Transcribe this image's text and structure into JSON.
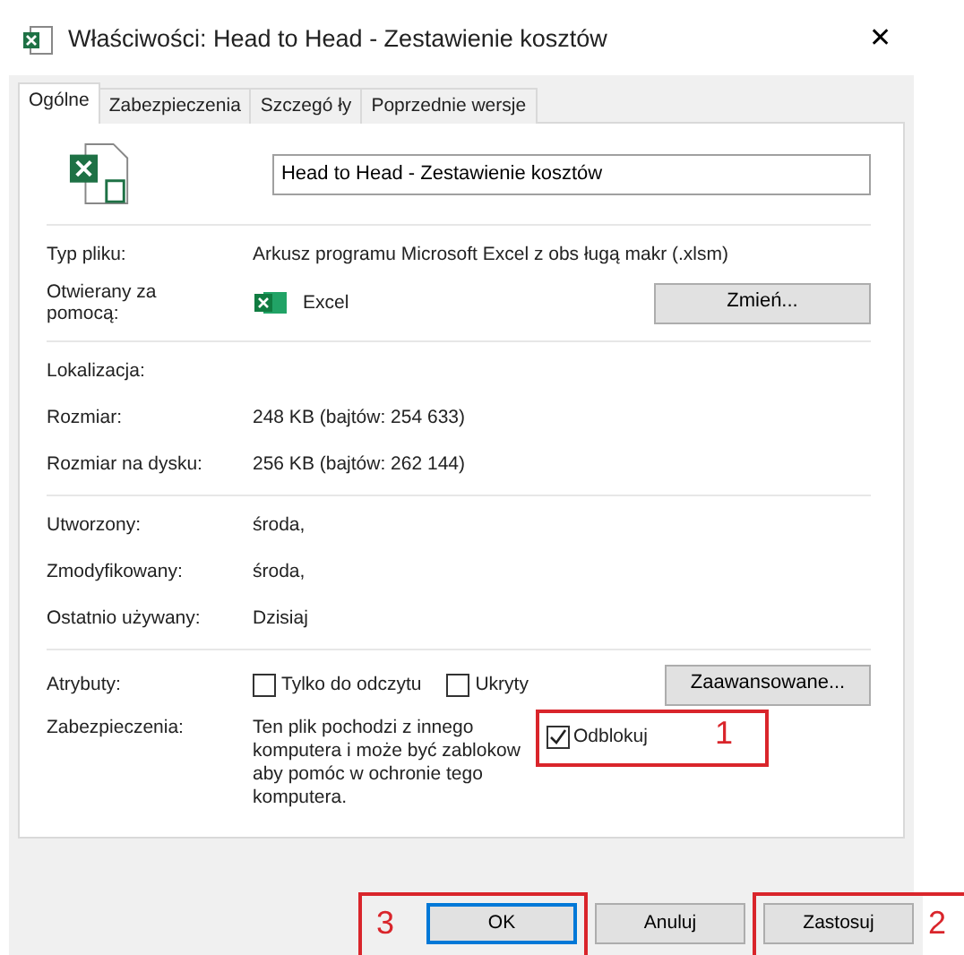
{
  "window": {
    "title": "Właściwości: Head to Head - Zestawienie kosztów",
    "close": "✕"
  },
  "tabs": [
    {
      "label": "Ogólne",
      "selected": true
    },
    {
      "label": "Zabezpieczenia",
      "selected": false
    },
    {
      "label": "Szczegó ły",
      "selected": false
    },
    {
      "label": "Poprzednie wersje",
      "selected": false
    }
  ],
  "file_name": "Head to Head - Zestawienie kosztów",
  "type_row": {
    "label": "Typ pliku:",
    "value": "Arkusz programu Microsoft Excel z obs ługą makr (.xlsm)"
  },
  "opens_with": {
    "label": "Otwierany za pomocą:",
    "app": "Excel",
    "button": "Zmień..."
  },
  "location_rows": [
    {
      "label": "Lokalizacja:",
      "value": ""
    },
    {
      "label": "Rozmiar:",
      "value": "248 KB (bajtów: 254 633)"
    },
    {
      "label": "Rozmiar na dysku:",
      "value": "256 KB (bajtów: 262 144)"
    }
  ],
  "date_rows": [
    {
      "label": "Utworzony:",
      "value": "środa,"
    },
    {
      "label": "Zmodyfikowany:",
      "value": "środa,"
    },
    {
      "label": "Ostatnio używany:",
      "value": "Dzisiaj"
    }
  ],
  "attributes": {
    "label": "Atrybuty:",
    "checkboxes": [
      {
        "label": "Tylko do odczytu",
        "checked": false
      },
      {
        "label": "Ukryty",
        "checked": false
      }
    ],
    "button": "Zaawansowane..."
  },
  "security": {
    "label": "Zabezpieczenia:",
    "lines": [
      "Ten plik pochodzi z innego",
      "komputera i może być zablokow",
      "aby pomóc w ochronie tego",
      "komputera."
    ],
    "unblock": {
      "label": "Odblokuj",
      "checked": true,
      "annotation": "1"
    }
  },
  "buttons": [
    {
      "label": "OK",
      "default": true,
      "annotation": "3"
    },
    {
      "label": "Anuluj",
      "default": false
    },
    {
      "label": "Zastosuj",
      "default": false,
      "annotation": "2"
    }
  ]
}
